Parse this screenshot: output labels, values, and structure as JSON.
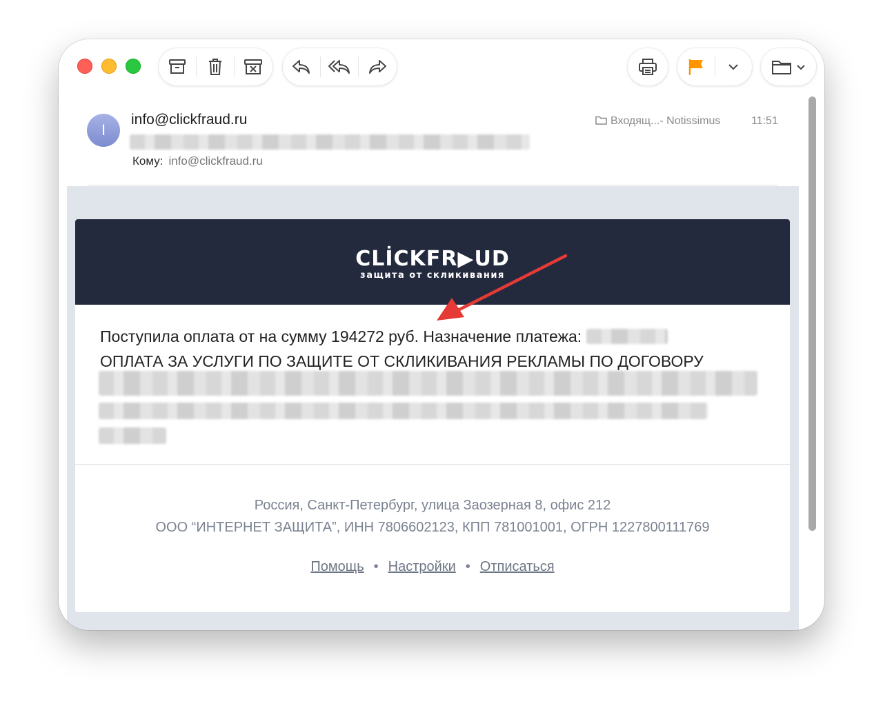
{
  "toolbar": {
    "group1": [
      "archive-icon",
      "trash-icon",
      "junk-icon"
    ],
    "group2": [
      "reply-icon",
      "reply-all-icon",
      "forward-icon"
    ],
    "print": "printer-icon",
    "flag": {
      "icon": "flag-icon",
      "color": "#ff9500"
    },
    "move": "folder-icon"
  },
  "message": {
    "avatar_initial": "I",
    "sender": "info@clickfraud.ru",
    "to_label": "Кому:",
    "to_value": "info@clickfraud.ru",
    "folder": "Входящ...- Notissimus",
    "time": "11:51"
  },
  "email": {
    "logo_text": "CLİCKFR▶UD",
    "logo_subtitle": "защита от скликивания",
    "line1": "Поступила оплата от на сумму 194272 руб. Назначение платежа:",
    "line2": "ОПЛАТА ЗА УСЛУГИ ПО ЗАЩИТЕ ОТ СКЛИКИВАНИЯ РЕКЛАМЫ ПО ДОГОВОРУ",
    "address": "Россия, Санкт-Петербург, улица Заозерная 8, офис 212",
    "company": "ООО “ИНТЕРНЕТ ЗАЩИТА”, ИНН 7806602123, КПП 781001001, ОГРН 1227800111769",
    "links": [
      "Помощь",
      "Настройки",
      "Отписаться"
    ],
    "separator": "•"
  },
  "colors": {
    "banner": "#232a3d",
    "annotation_arrow": "#e53a35"
  }
}
